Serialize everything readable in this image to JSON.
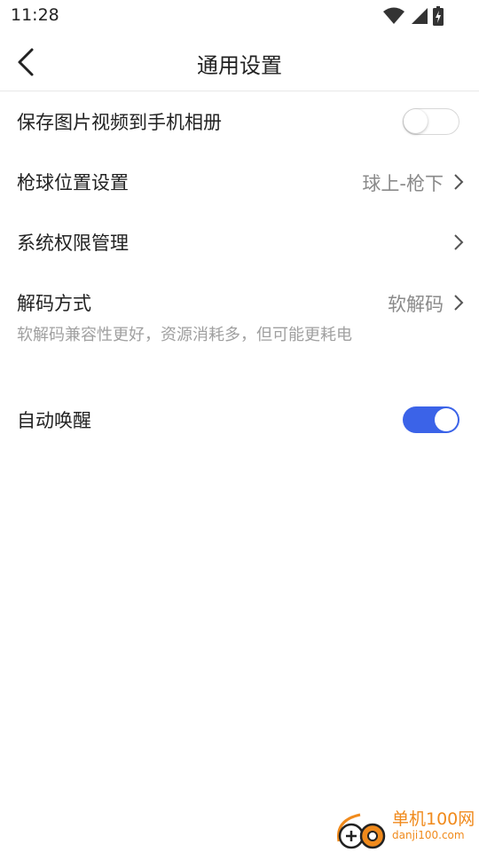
{
  "status_bar": {
    "time": "11:28",
    "icons": [
      "wifi-icon",
      "cell-signal-icon",
      "battery-charging-icon"
    ]
  },
  "header": {
    "title": "通用设置",
    "back_icon": "back-arrow-icon"
  },
  "settings": [
    {
      "label": "保存图片视频到手机相册",
      "type": "toggle",
      "enabled": false
    },
    {
      "label": "枪球位置设置",
      "type": "link",
      "value": "球上-枪下"
    },
    {
      "label": "系统权限管理",
      "type": "link"
    },
    {
      "label": "解码方式",
      "type": "link",
      "value": "软解码",
      "description": "软解码兼容性更好，资源消耗多，但可能更耗电"
    },
    {
      "label": "自动唤醒",
      "type": "toggle",
      "enabled": true
    }
  ],
  "colors": {
    "toggle_on": "#3b63e8",
    "value_text": "#8a8a8a",
    "watermark": "#f08a1c"
  },
  "watermark": {
    "cn": "单机100网",
    "en": "danji100.com"
  }
}
